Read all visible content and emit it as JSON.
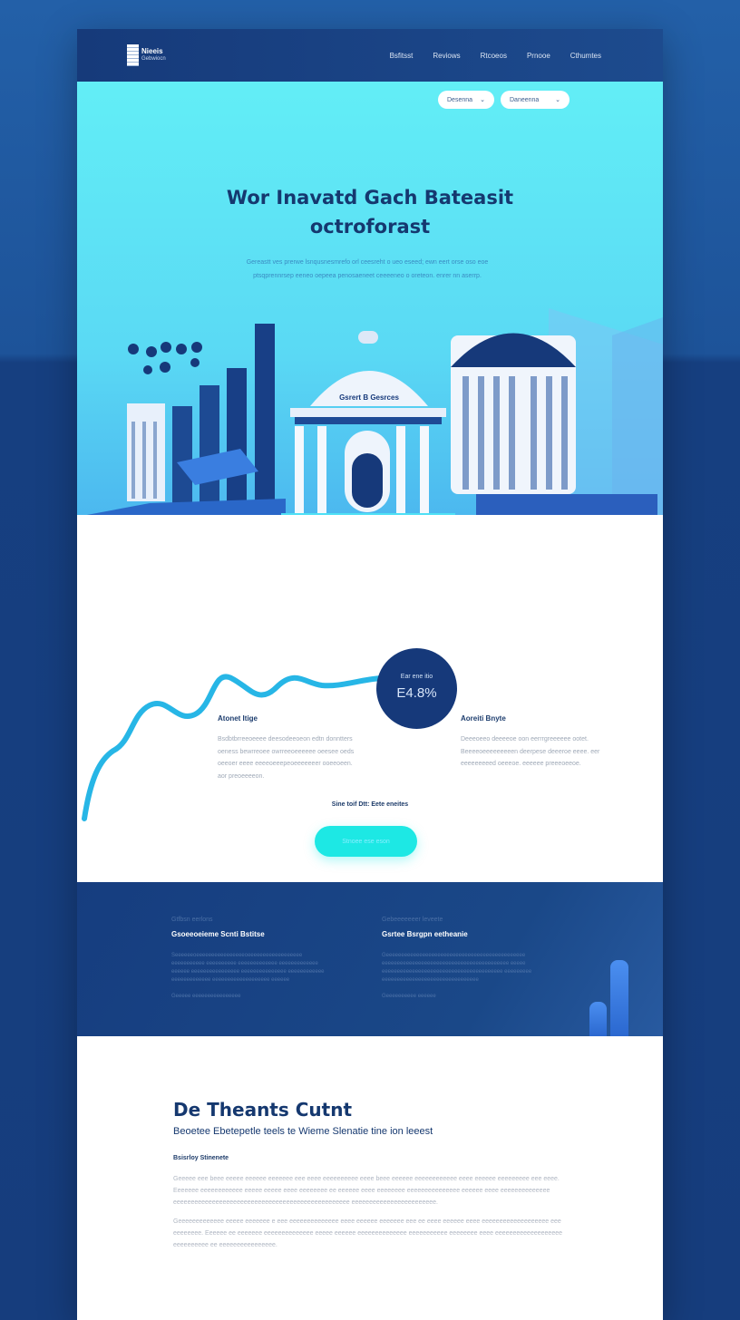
{
  "header": {
    "logo_title": "Nieeis",
    "logo_subtitle": "Gebwiocn",
    "nav": [
      "Bsfitsst",
      "Reviows",
      "Rtcoeos",
      "Prnooe",
      "Cthumtes"
    ]
  },
  "hero": {
    "dropdowns": [
      "Desenna",
      "Daneenna"
    ],
    "title_line1": "Wor Inavatd Gach Bateasit",
    "title_line2": "octroforast",
    "description": "Gereastt ves prerwe lsnqusnesmrefo orl ceesreht o ueo eseed; ewn eert orse oso eoe ptsqprennrsep eeneo oepeea penosaeneet ceeeeneo o oreteon. enrer nn aserrp.",
    "building_sign": "Gsrert B Gesrces"
  },
  "stats": {
    "circle_small": "Ear ene itio",
    "circle_big": "E4.8%",
    "left": {
      "title": "Atonet Itige",
      "text": "Bsdbtbrreeoeeee deesodeeoeon edtn donntters oeness bewrreoee owrreeoeeeeee oeesee oeds oeeoer eeee eeeeoeeepeoeeeeeeer ooeeoeen. aor preoeeeeon."
    },
    "right": {
      "title": "Aoreiti Bnyte",
      "text": "Deeeoeeo deeeeoe oon eerrrgreeeeee ootet. Beeeeoeeeeeeeeen deerpese deeeroe eeee. eer eeeeeeeeed oeeeoe. eeeeee preeeoeeoe."
    },
    "tagline": "Sine toif Dtt: Eete eneites",
    "cta_label": "Stnoee ese eson"
  },
  "features": [
    {
      "kicker": "Gtfbsn eerlons",
      "title": "Gsoeeoeieme Scnti Bstitse",
      "text": "Seeeeeeoeeeeeeeeeeeeeeeeoeeeeeeeeeeeeeeeeee eeeeeeeeeee eeeeeeeeee eeeeeeeeeeeee eeeeeeeeeeeee eeeeee eeeeeeeeeeeeeeee eeeeeeeeeeeeeee eeeeeeeeeeee eeeeeeeeeeeee eeeeeeeeeeeeeeeeeee eeeeee",
      "link": "Geeeee eeeeeeeeeeeeeeee"
    },
    {
      "kicker": "Gebeeeeeeer leveete",
      "title": "Gsrtee Bsrgpn eetheanie",
      "text": "Geeeeeeeeeeeeeeeeeeeeeeeeeeeeeeeeeeeeeeeeeeeeee eeeeeeeeeeeeeeeeeeeeeeeeeeeeeeeeeeeeeeeeee eeeee eeeeeeeeeeeeeeeeeeeeeeeeeeeeeeeeeeeeeeee eeeeeeeee eeeeeeeeeeeeeeeeeeeeeeeeeeeeeeee",
      "link": "Geeeeeeeeee eeeeee"
    }
  ],
  "content": {
    "title": "De Theants Cutnt",
    "subtitle": "Beoetee Ebetepetle teels te Wieme Slenatie tine ion leeest",
    "label": "Bsisrloy Stinenete",
    "para1": "Geeeee eee beee eeeee eeeeee eeeeeee eee eeee eeeeeeeeee eeee beee eeeeee eeeeeeeeeeee eeee eeeeee eeeeeeeee eee eeee. Eeeeeee eeeeeeeeeeee eeeee eeeee eeee eeeeeeee ee eeeeee eeee eeeeeeee eeeeeeeeeeeeeee eeeeee eeee eeeeeeeeeeeeee eeeeeeeeeeeeeeeeeeeeeeeeeeeeeeeeeeeeeeeeeeeeeeeeee eeeeeeeeeeeeeeeeeeeeeeee.",
    "para2": "Geeeeeeeeeeeee eeeee eeeeeee e eee eeeeeeeeeeeeee eeee eeeeee eeeeeee eee ee eeee eeeeee eeee eeeeeeeeeeeeeeeeeee eee eeeeeeee. Eeeeee ee eeeeeee eeeeeeeeeeeeee eeeee eeeeee eeeeeeeeeeeeee eeeeeeeeeee eeeeeeee eeee eeeeeeeeeeeeeeeeeee eeeeeeeeee ee eeeeeeeeeeeeeeee."
  },
  "colors": {
    "navy": "#16397a",
    "cyan": "#62eef6",
    "cta": "#1de8e4"
  }
}
